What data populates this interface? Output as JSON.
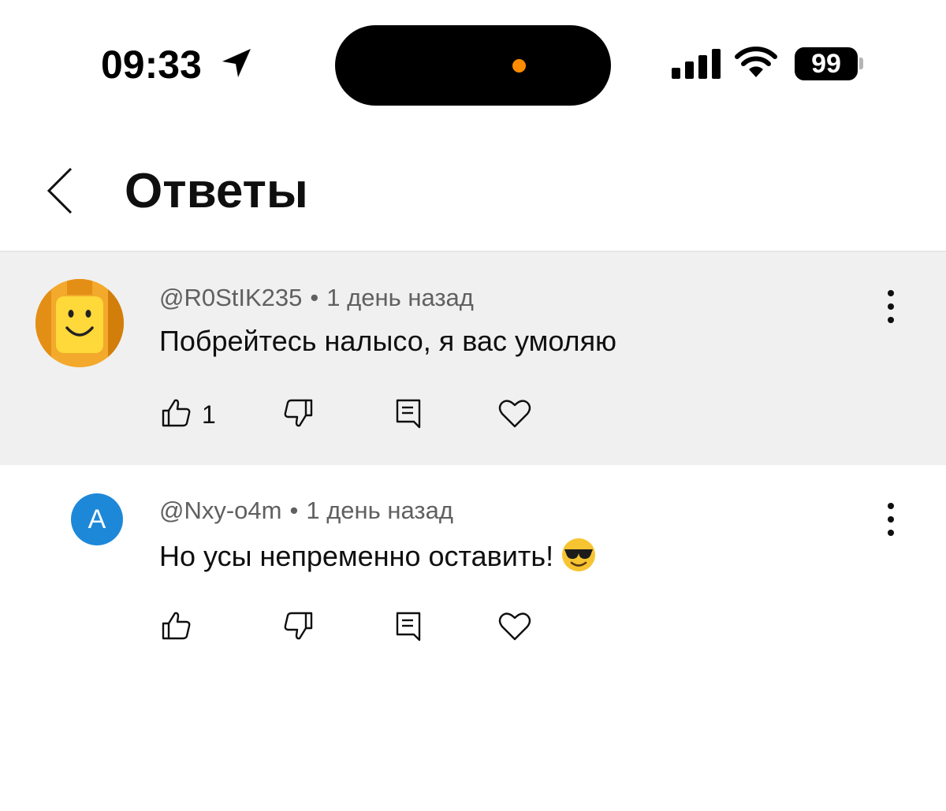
{
  "status_bar": {
    "time": "09:33",
    "battery_level": "99",
    "island_dot_color": "#ff8c00"
  },
  "header": {
    "title": "Ответы",
    "back_icon": "chevron-left-icon"
  },
  "comments": [
    {
      "author": "@R0StIK235",
      "separator": "•",
      "time": "1 день назад",
      "text": "Побрейтесь налысо, я вас умоляю",
      "like_count": "1",
      "avatar_color": "#f3a92b",
      "highlighted": true
    },
    {
      "author": "@Nxy-o4m",
      "separator": "•",
      "time": "1 день назад",
      "text": "Но усы непременно оставить!",
      "emoji": "smiling-face-with-sunglasses",
      "avatar_letter": "A",
      "avatar_color": "#1e88d8",
      "highlighted": false
    }
  ]
}
